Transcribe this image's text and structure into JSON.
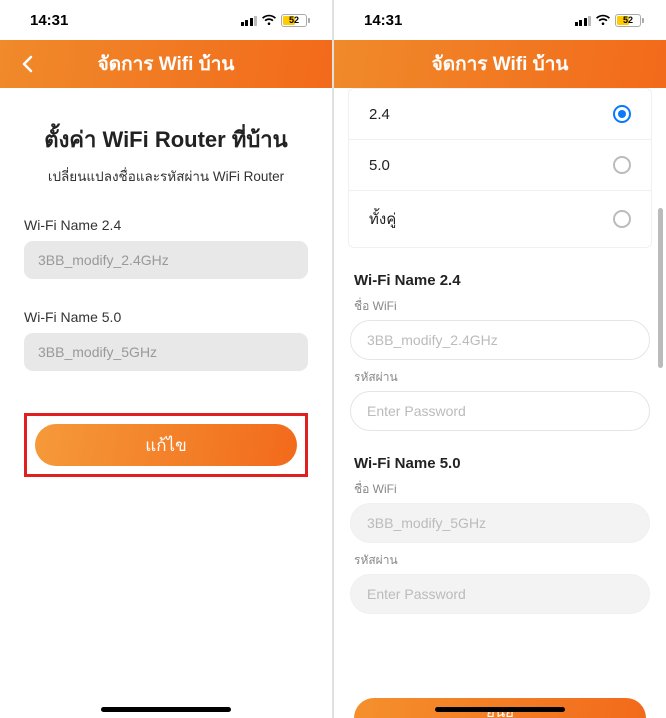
{
  "status": {
    "time": "14:31",
    "battery": "52"
  },
  "header": {
    "title": "จัดการ Wifi บ้าน"
  },
  "left": {
    "heading": "ตั้งค่า WiFi Router ที่บ้าน",
    "subheading": "เปลี่ยนแปลงชื่อและรหัสผ่าน WiFi Router",
    "wifi24_label": "Wi-Fi Name 2.4",
    "wifi24_value": "3BB_modify_2.4GHz",
    "wifi50_label": "Wi-Fi Name 5.0",
    "wifi50_value": "3BB_modify_5GHz",
    "edit_button": "แก้ไข"
  },
  "right": {
    "options": {
      "opt24": "2.4",
      "opt50": "5.0",
      "both": "ทั้งคู่"
    },
    "section24": {
      "title": "Wi-Fi Name 2.4",
      "name_label": "ชื่อ WiFi",
      "name_value": "3BB_modify_2.4GHz",
      "pass_label": "รหัสผ่าน",
      "pass_placeholder": "Enter Password"
    },
    "section50": {
      "title": "Wi-Fi Name 5.0",
      "name_label": "ชื่อ WiFi",
      "name_value": "3BB_modify_5GHz",
      "pass_label": "รหัสผ่าน",
      "pass_placeholder": "Enter Password"
    },
    "save_button": "ยนย"
  }
}
